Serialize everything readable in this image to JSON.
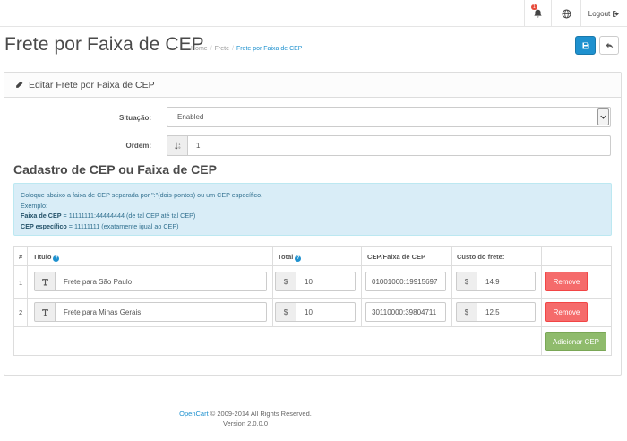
{
  "header": {
    "notification_count": "1",
    "logout_label": "Logout"
  },
  "page": {
    "title": "Frete por Faixa de CEP",
    "breadcrumbs": [
      "Home",
      "Frete",
      "Frete por Faixa de CEP"
    ]
  },
  "panel": {
    "heading": "Editar Frete por Faixa de CEP"
  },
  "form": {
    "status_label": "Situação:",
    "status_value": "Enabled",
    "order_label": "Ordem:",
    "order_value": "1"
  },
  "section": {
    "title": "Cadastro de CEP ou Faixa de CEP"
  },
  "info": {
    "line1": "Coloque abaixo a faixa de CEP separada por \":\"(dois-pontos) ou um CEP específico.",
    "line2": "Exemplo:",
    "line3_bold": "Faixa de CEP",
    "line3_rest": " = 11111111:44444444 (de tal CEP até tal CEP)",
    "line4_bold": "CEP específico",
    "line4_rest": " = 11111111 (exatamente igual ao CEP)"
  },
  "table": {
    "headers": {
      "num": "#",
      "title": "Título",
      "total": "Total",
      "cep": "CEP/Faixa de CEP",
      "cost": "Custo do frete:"
    },
    "currency_symbol": "$",
    "rows": [
      {
        "num": "1",
        "title": "Frete para São Paulo",
        "total": "10",
        "cep": "01001000:19915697",
        "cost": "14.9"
      },
      {
        "num": "2",
        "title": "Frete para Minas Gerais",
        "total": "10",
        "cep": "30110000:39804711",
        "cost": "12.5"
      }
    ],
    "remove_label": "Remove",
    "add_label": "Adicionar CEP"
  },
  "footer": {
    "brand": "OpenCart",
    "copyright": " © 2009-2014 All Rights Reserved.",
    "version": "Version 2.0.0.0"
  },
  "colors": {
    "primary": "#1e91cf",
    "danger": "#f56b6b",
    "success": "#8fbb6c",
    "info_bg": "#d9edf7"
  }
}
